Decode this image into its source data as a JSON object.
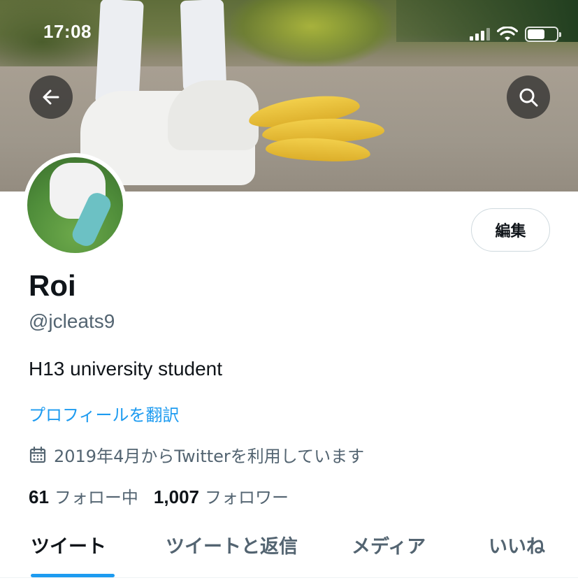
{
  "status_bar": {
    "time": "17:08"
  },
  "profile": {
    "display_name": "Roi",
    "handle": "@jcleats9",
    "bio": "H13 university student",
    "translate_link": "プロフィールを翻訳",
    "joined": "2019年4月からTwitterを利用しています",
    "following_count": "61",
    "following_label": "フォロー中",
    "followers_count": "1,007",
    "followers_label": "フォロワー"
  },
  "actions": {
    "edit_label": "編集"
  },
  "tabs": [
    {
      "label": "ツイート",
      "active": true
    },
    {
      "label": "ツイートと返信",
      "active": false
    },
    {
      "label": "メディア",
      "active": false
    },
    {
      "label": "いいね",
      "active": false
    }
  ],
  "icons": {
    "back": "arrow-left-icon",
    "search": "search-icon",
    "calendar": "calendar-icon",
    "signal": "cellular-signal-icon",
    "wifi": "wifi-icon",
    "battery": "battery-icon"
  },
  "colors": {
    "accent": "#1d9bf0",
    "secondary_text": "#536471",
    "primary_text": "#0f1419"
  }
}
